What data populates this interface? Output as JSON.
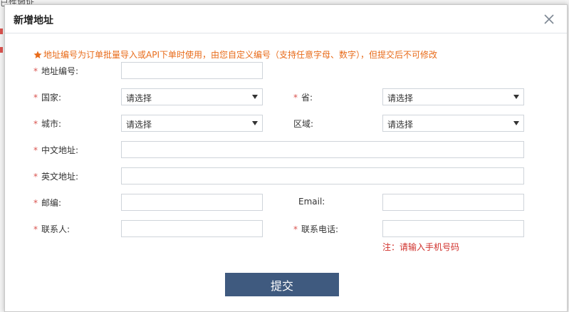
{
  "background": {
    "text": "已性地址"
  },
  "dialog": {
    "title": "新增地址",
    "notice": "地址编号为订单批量导入或API下单时使用，由您自定义编号（支持任意字母、数字），但提交后不可修改"
  },
  "form": {
    "required_mark": "*",
    "address_code": {
      "label": "地址编号:",
      "value": ""
    },
    "country": {
      "label": "国家:",
      "selected": "请选择"
    },
    "province": {
      "label": "省:",
      "selected": "请选择"
    },
    "city": {
      "label": "城市:",
      "selected": "请选择"
    },
    "district": {
      "label": "区域:",
      "selected": "请选择"
    },
    "address_cn": {
      "label": "中文地址:",
      "value": ""
    },
    "address_en": {
      "label": "英文地址:",
      "value": ""
    },
    "postcode": {
      "label": "邮编:",
      "value": ""
    },
    "email": {
      "label": "Email:",
      "value": ""
    },
    "contact": {
      "label": "联系人:",
      "value": ""
    },
    "phone": {
      "label": "联系电话:",
      "value": ""
    },
    "phone_hint": "注：请输入手机号码",
    "submit_label": "提交"
  },
  "colors": {
    "accent": "#3f5a7f",
    "required": "#d9534f",
    "notice": "#e86b1a",
    "hint": "#d0302b"
  },
  "icons": {
    "close": "close-icon",
    "notice": "star-icon",
    "dropdown": "caret-down-icon"
  }
}
